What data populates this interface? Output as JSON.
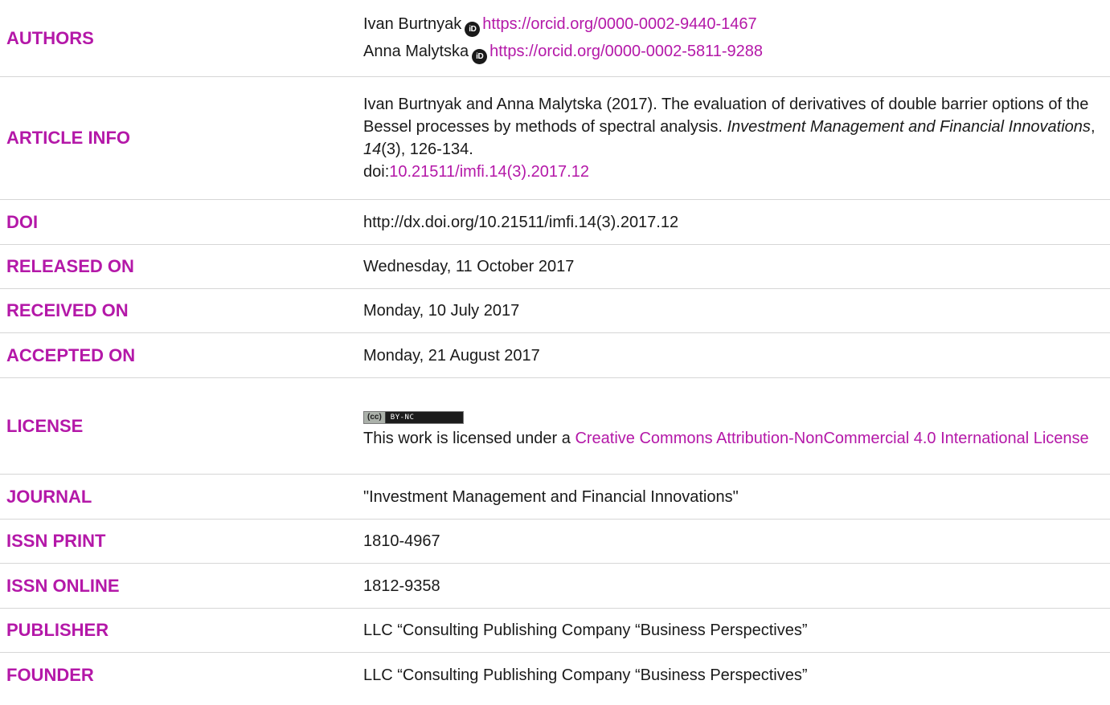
{
  "authors": {
    "label": "AUTHORS",
    "list": [
      {
        "name": "Ivan Burtnyak",
        "orcid_url": "https://orcid.org/0000-0002-9440-1467"
      },
      {
        "name": "Anna Malytska",
        "orcid_url": "https://orcid.org/0000-0002-5811-9288"
      }
    ]
  },
  "article_info": {
    "label": "ARTICLE INFO",
    "citation_lead": "Ivan Burtnyak and Anna Malytska (2017). The evaluation of derivatives of double barrier options of the Bessel processes by methods of spectral analysis.",
    "journal_italic": "Investment Management and Financial Innovations",
    "sep1": ", ",
    "volume_italic": "14",
    "issue_pages": "(3), 126-134.",
    "doi_prefix": "doi:",
    "doi_link": "10.21511/imfi.14(3).2017.12"
  },
  "doi": {
    "label": "DOI",
    "value": "http://dx.doi.org/10.21511/imfi.14(3).2017.12"
  },
  "released": {
    "label": "RELEASED ON",
    "value": "Wednesday, 11 October 2017"
  },
  "received": {
    "label": "RECEIVED ON",
    "value": "Monday, 10 July 2017"
  },
  "accepted": {
    "label": "ACCEPTED ON",
    "value": "Monday, 21 August 2017"
  },
  "license": {
    "label": "LICENSE",
    "badge_logo": "(cc)",
    "badge_text": "BY-NC",
    "text_lead": "This work is licensed under a ",
    "link_text": "Creative Commons Attribution-NonCommercial 4.0 International License"
  },
  "journal": {
    "label": "JOURNAL",
    "value": "\"Investment Management and Financial Innovations\""
  },
  "issn_print": {
    "label": "ISSN PRINT",
    "value": "1810-4967"
  },
  "issn_online": {
    "label": "ISSN ONLINE",
    "value": "1812-9358"
  },
  "publisher": {
    "label": "PUBLISHER",
    "value": "LLC “Consulting Publishing Company “Business Perspectives”"
  },
  "founder": {
    "label": "FOUNDER",
    "value": "LLC “Consulting Publishing Company “Business Perspectives”"
  },
  "icons": {
    "orcid": "orcid-icon",
    "orcid_glyph": "iD"
  },
  "colors": {
    "accent": "#b418a8",
    "text": "#1a1a1a",
    "divider": "#d6d6d6"
  }
}
